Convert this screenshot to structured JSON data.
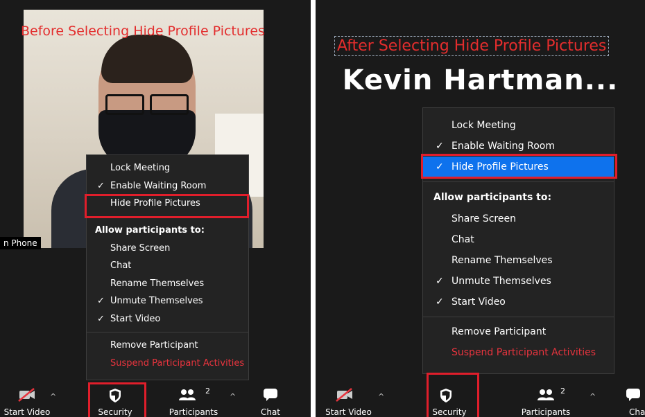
{
  "left": {
    "caption": "Before Selecting Hide Profile Pictures",
    "name_tag": "n Phone",
    "menu": {
      "lock_meeting": "Lock Meeting",
      "enable_waiting_room": "Enable Waiting Room",
      "hide_profile_pictures": "Hide Profile Pictures",
      "allow_header": "Allow participants to:",
      "share_screen": "Share Screen",
      "chat": "Chat",
      "rename_themselves": "Rename Themselves",
      "unmute_themselves": "Unmute Themselves",
      "start_video": "Start Video",
      "remove_participant": "Remove Participant",
      "suspend_activities": "Suspend Participant Activities"
    },
    "toolbar": {
      "start_video": "Start Video",
      "security": "Security",
      "participants": "Participants",
      "participants_count": "2",
      "chat": "Chat"
    }
  },
  "right": {
    "caption": "After Selecting Hide Profile Pictures",
    "display_name": "Kevin Hartman...",
    "menu": {
      "lock_meeting": "Lock Meeting",
      "enable_waiting_room": "Enable Waiting Room",
      "hide_profile_pictures": "Hide Profile Pictures",
      "allow_header": "Allow participants to:",
      "share_screen": "Share Screen",
      "chat": "Chat",
      "rename_themselves": "Rename Themselves",
      "unmute_themselves": "Unmute Themselves",
      "start_video": "Start Video",
      "remove_participant": "Remove Participant",
      "suspend_activities": "Suspend Participant Activities"
    },
    "toolbar": {
      "start_video": "Start Video",
      "security": "Security",
      "participants": "Participants",
      "participants_count": "2",
      "chat": "Cha"
    }
  },
  "glyphs": {
    "check": "✓",
    "caret_up": "^"
  },
  "colors": {
    "menu_bg": "#232323",
    "selected_bg": "#0e72ed",
    "danger_text": "#e8343e",
    "annotation_red": "#e01e2b",
    "caption_red": "#e32d2d"
  }
}
